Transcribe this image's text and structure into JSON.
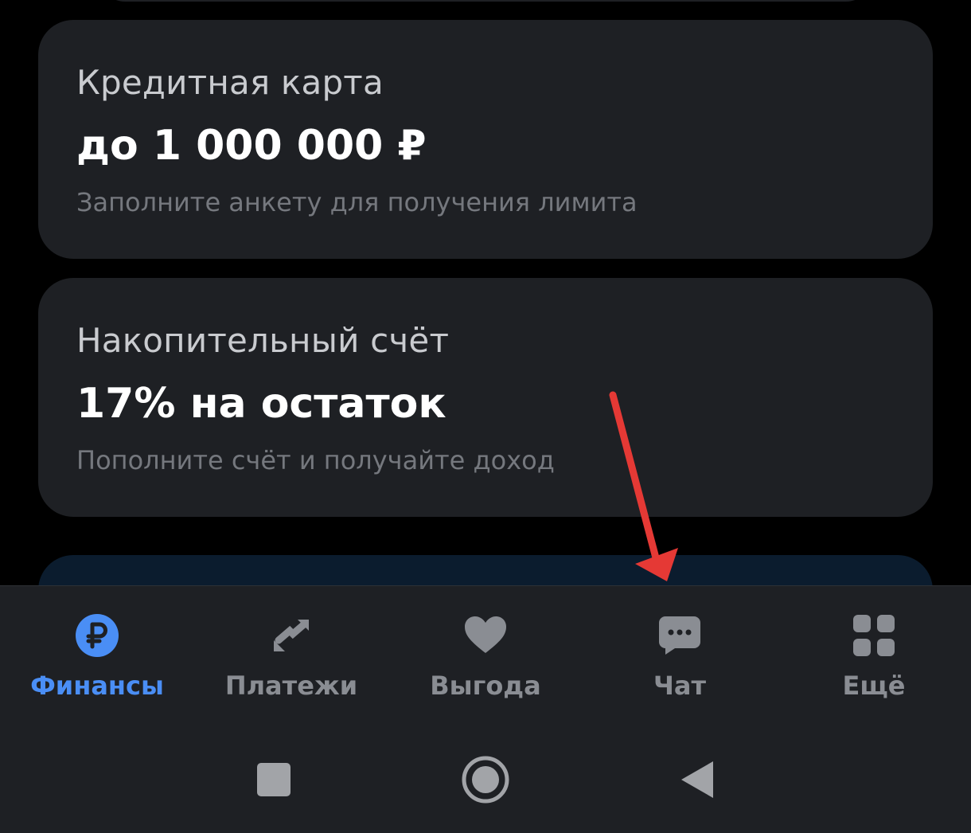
{
  "cards": [
    {
      "title": "Кредитная карта",
      "headline": "до 1 000 000 ₽",
      "subtitle": "Заполните анкету для получения лимита"
    },
    {
      "title": "Накопительный счёт",
      "headline": "17% на остаток",
      "subtitle": "Пополните счёт и получайте доход"
    }
  ],
  "tabbar": {
    "active_tab": "Финансы",
    "tabs": [
      {
        "label": "Финансы",
        "icon": "ruble-icon",
        "active": true
      },
      {
        "label": "Платежи",
        "icon": "transfer-arrows-icon",
        "active": false
      },
      {
        "label": "Выгода",
        "icon": "heart-icon",
        "active": false
      },
      {
        "label": "Чат",
        "icon": "chat-bubble-icon",
        "active": false
      },
      {
        "label": "Ещё",
        "icon": "grid-icon",
        "active": false
      }
    ]
  },
  "system_nav": {
    "buttons": [
      "recents-icon",
      "home-icon",
      "back-icon"
    ]
  },
  "colors": {
    "background": "#000000",
    "card": "#1e2024",
    "accent": "#4a8ef5",
    "inactive": "#8a8d93",
    "annotation_arrow": "#e53935"
  }
}
